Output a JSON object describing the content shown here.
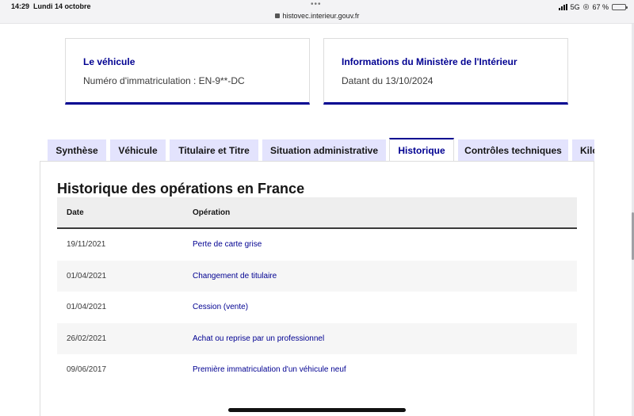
{
  "status_bar": {
    "time": "14:29",
    "date": "Lundi 14 octobre",
    "url": "histovec.interieur.gouv.fr",
    "network": "5G",
    "battery": "67 %",
    "battery_level": 0.67
  },
  "cards": [
    {
      "title": "Le véhicule",
      "text": "Numéro d'immatriculation : EN-9**-DC"
    },
    {
      "title": "Informations du Ministère de l'Intérieur",
      "text": "Datant du 13/10/2024"
    }
  ],
  "tabs": [
    {
      "label": "Synthèse",
      "active": false
    },
    {
      "label": "Véhicule",
      "active": false
    },
    {
      "label": "Titulaire et Titre",
      "active": false
    },
    {
      "label": "Situation administrative",
      "active": false
    },
    {
      "label": "Historique",
      "active": true
    },
    {
      "label": "Contrôles techniques",
      "active": false
    },
    {
      "label": "Kilo",
      "active": false
    }
  ],
  "section": {
    "title": "Historique des opérations en France",
    "columns": {
      "date": "Date",
      "operation": "Opération"
    },
    "rows": [
      {
        "date": "19/11/2021",
        "operation": "Perte de carte grise"
      },
      {
        "date": "01/04/2021",
        "operation": "Changement de titulaire"
      },
      {
        "date": "01/04/2021",
        "operation": "Cession (vente)"
      },
      {
        "date": "26/02/2021",
        "operation": "Achat ou reprise par un professionnel"
      },
      {
        "date": "09/06/2017",
        "operation": "Première immatriculation d'un véhicule neuf"
      }
    ]
  },
  "colors": {
    "accent": "#000091",
    "tab_bg": "#e3e3fd",
    "row_shade": "#f6f6f6"
  }
}
